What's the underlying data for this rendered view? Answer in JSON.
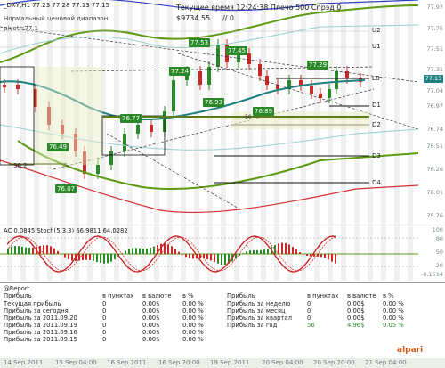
{
  "header": {
    "symbol_line": "_DXY,H1  77.23 77.28 77.13 77.15",
    "subtitle": "Нормальный ценовой диапазон",
    "pivot_label": "pivot=77.1",
    "server_time": "Текущее время 12:24:38 Плечо 500 Спрэд 0",
    "balance": "$9734.55",
    "balance_suffix": "// 0"
  },
  "price_axis": [
    "77.97",
    "77.75",
    "77.51",
    "77.31",
    "77.04",
    "76.97",
    "76.74",
    "76.51",
    "76.26",
    "76.01",
    "75.76"
  ],
  "current_price": "77.15",
  "level_labels": [
    "U2",
    "U1",
    "LB",
    "D1",
    "D2",
    "D3",
    "D4"
  ],
  "annotations": [
    "77.53",
    "77.45",
    "77.29",
    "77.24",
    "76.77",
    "76.93",
    "76.89",
    "76.49",
    "76.07",
    "38.2",
    "50"
  ],
  "indicator": {
    "title": "AC 0.0845  Stoch(5,3,3) 66.9811 64.0282",
    "scale": [
      "100",
      "80",
      "50",
      "20",
      "-0.1514"
    ]
  },
  "report": {
    "title": "@Report",
    "left_headers": [
      "Прибыль",
      "в пунктах",
      "в валюте",
      "в %"
    ],
    "left_rows": [
      [
        "Текущая прибыль",
        "0",
        "0.00$",
        "0.00 %"
      ],
      [
        "Прибыль за сегодня",
        "0",
        "0.00$",
        "0.00 %"
      ],
      [
        "Прибыль за 2011.09.20",
        "0",
        "0.00$",
        "0.00 %"
      ],
      [
        "Прибыль за 2011.09.19",
        "0",
        "0.00$",
        "0.00 %"
      ],
      [
        "Прибыль за 2011.09.16",
        "0",
        "0.00$",
        "0.00 %"
      ],
      [
        "Прибыль за 2011.09.15",
        "0",
        "0.00$",
        "0.00 %"
      ]
    ],
    "right_headers": [
      "Прибыль",
      "в пунктах",
      "в валюте",
      "в %"
    ],
    "right_rows": [
      [
        "Прибыль за неделю",
        "0",
        "0.00$",
        "0.00 %"
      ],
      [
        "Прибыль за месяц",
        "0",
        "0.00$",
        "0.00 %"
      ],
      [
        "Прибыль за квартал",
        "0",
        "0.00$",
        "0.00 %"
      ],
      [
        "Прибыль за год",
        "56",
        "4.96$",
        "0.05 %"
      ]
    ],
    "brand": "alpari"
  },
  "time_axis": [
    "14 Sep 2011",
    "15 Sep 04:00",
    "16 Sep 2011",
    "16 Sep 20:00",
    "19 Sep 2011",
    "20 Sep 04:00",
    "20 Sep 20:00",
    "21 Sep 04:00"
  ],
  "colors": {
    "bull": "#2a8a2a",
    "bear": "#c82828",
    "ma_teal": "#1e7f7f",
    "band_green": "#6aa11e",
    "band_red": "#d23030",
    "band_blue": "#3040c0"
  }
}
